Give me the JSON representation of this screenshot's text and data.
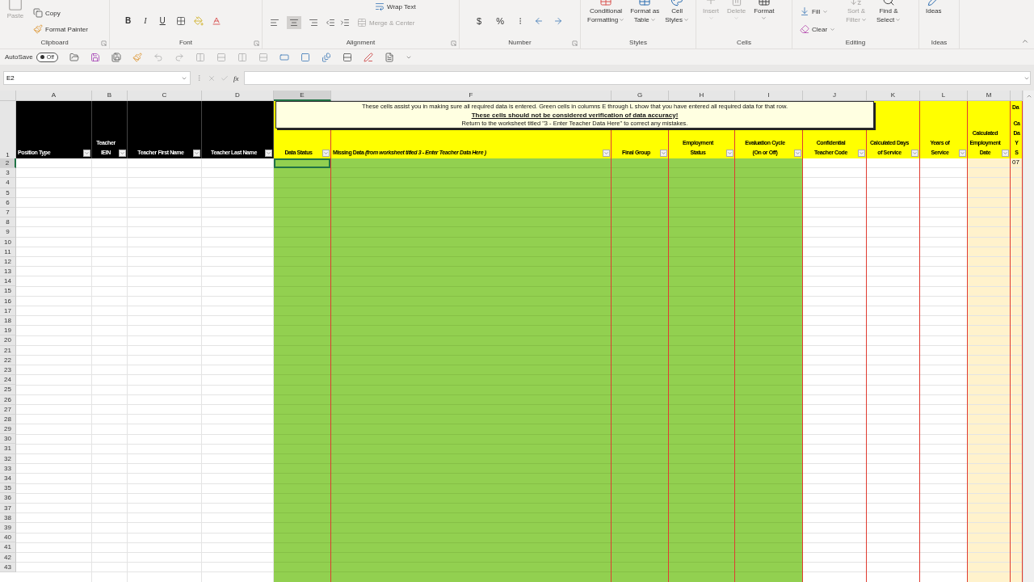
{
  "ribbon": {
    "clipboard": {
      "label": "Clipboard",
      "paste": {
        "label": "Paste",
        "disabled": true
      },
      "copy": "Copy",
      "format_painter": "Format Painter"
    },
    "font": {
      "label": "Font",
      "bold": "B",
      "italic": "I",
      "underline": "U"
    },
    "alignment": {
      "label": "Alignment",
      "wrap_text": "Wrap Text",
      "align": [
        {
          "selected": false
        },
        {
          "selected": true
        },
        {
          "selected": false
        }
      ],
      "merge_center": {
        "label": "Merge & Center",
        "disabled": true
      }
    },
    "number": {
      "label": "Number",
      "currency": "$",
      "percent": "%"
    },
    "styles": {
      "label": "Styles",
      "buttons": [
        {
          "line_1": "Conditional",
          "line_2": "Formatting"
        },
        {
          "line_1": "Format as",
          "line_2": "Table"
        },
        {
          "line_1": "Cell",
          "line_2": "Styles"
        }
      ]
    },
    "cells": {
      "label": "Cells",
      "buttons": [
        {
          "label": "Insert",
          "disabled": true
        },
        {
          "label": "Delete",
          "disabled": true
        },
        {
          "label": "Format",
          "disabled": false
        }
      ]
    },
    "editing": {
      "label": "Editing",
      "fill": "Fill",
      "clear": "Clear",
      "buttons": [
        {
          "line_1": "Sort &",
          "line_2": "Filter",
          "disabled": true
        },
        {
          "line_1": "Find &",
          "line_2": "Select",
          "disabled": false
        }
      ]
    },
    "ideas": {
      "label": "Ideas",
      "button": "Ideas"
    }
  },
  "quick_access": {
    "autosave_label": "AutoSave",
    "autosave_on": false,
    "autosave_state": "Off"
  },
  "formula_bar": {
    "name_box": "E2",
    "function_label": "fx"
  },
  "note": {
    "line_1": "These cells assist you in making sure all required data is entered.  Green cells in columns E through L show that you have entered all required data for that row.",
    "warning": "These cells should not be considered verification of data accuracy!",
    "line_3": "Return to the worksheet titled \"3 - Enter Teacher Data Here\" to correct any mistakes."
  },
  "columns": [
    {
      "letter": "A",
      "header": "Position Type",
      "kind": "input",
      "selected": false
    },
    {
      "letter": "B",
      "header": "Teacher\nIEIN",
      "kind": "input",
      "selected": false
    },
    {
      "letter": "C",
      "header": "Teacher First Name",
      "kind": "input",
      "selected": false
    },
    {
      "letter": "D",
      "header": "Teacher Last Name",
      "kind": "input",
      "selected": false
    },
    {
      "letter": "E",
      "header": "Data Status",
      "kind": "check",
      "selected": true
    },
    {
      "letter": "F",
      "header": "Missing Data *(from worksheet titled 3 - Enter Teacher Data Here )*",
      "kind": "check",
      "selected": false
    },
    {
      "letter": "G",
      "header": "Final Group",
      "kind": "check",
      "selected": false
    },
    {
      "letter": "H",
      "header": "Employment\nStatus",
      "kind": "check",
      "selected": false
    },
    {
      "letter": "I",
      "header": "Evaluation Cycle\n(On or Off)",
      "kind": "check",
      "selected": false
    },
    {
      "letter": "J",
      "header": "Confidential\nTeacher Code",
      "kind": "calc",
      "selected": false
    },
    {
      "letter": "K",
      "header": "Calculated Days\nof Service",
      "kind": "calc",
      "selected": false
    },
    {
      "letter": "L",
      "header": "Years of\nService",
      "kind": "calc",
      "selected": false
    },
    {
      "letter": "M",
      "header": "Calculated\nEmployment\nDate",
      "kind": "date",
      "selected": false
    },
    {
      "header_top": "Da",
      "header": "Ca\nDa\nY\nS",
      "kind": "date",
      "selected": false,
      "first_value": "07"
    }
  ],
  "header_row": "1",
  "rows": [
    {
      "number": "2",
      "selected": true
    },
    {
      "number": "3",
      "selected": false
    },
    {
      "number": "4",
      "selected": false
    },
    {
      "number": "5",
      "selected": false
    },
    {
      "number": "6",
      "selected": false
    },
    {
      "number": "7",
      "selected": false
    },
    {
      "number": "8",
      "selected": false
    },
    {
      "number": "9",
      "selected": false
    },
    {
      "number": "10",
      "selected": false
    },
    {
      "number": "11",
      "selected": false
    },
    {
      "number": "12",
      "selected": false
    },
    {
      "number": "13",
      "selected": false
    },
    {
      "number": "14",
      "selected": false
    },
    {
      "number": "15",
      "selected": false
    },
    {
      "number": "16",
      "selected": false
    },
    {
      "number": "17",
      "selected": false
    },
    {
      "number": "18",
      "selected": false
    },
    {
      "number": "19",
      "selected": false
    },
    {
      "number": "20",
      "selected": false
    },
    {
      "number": "21",
      "selected": false
    },
    {
      "number": "22",
      "selected": false
    },
    {
      "number": "23",
      "selected": false
    },
    {
      "number": "24",
      "selected": false
    },
    {
      "number": "25",
      "selected": false
    },
    {
      "number": "26",
      "selected": false
    },
    {
      "number": "27",
      "selected": false
    },
    {
      "number": "28",
      "selected": false
    },
    {
      "number": "29",
      "selected": false
    },
    {
      "number": "30",
      "selected": false
    },
    {
      "number": "31",
      "selected": false
    },
    {
      "number": "32",
      "selected": false
    },
    {
      "number": "33",
      "selected": false
    },
    {
      "number": "34",
      "selected": false
    },
    {
      "number": "35",
      "selected": false
    },
    {
      "number": "36",
      "selected": false
    },
    {
      "number": "37",
      "selected": false
    },
    {
      "number": "38",
      "selected": false
    },
    {
      "number": "39",
      "selected": false
    },
    {
      "number": "40",
      "selected": false
    },
    {
      "number": "41",
      "selected": false
    },
    {
      "number": "42",
      "selected": false
    },
    {
      "number": "43",
      "selected": false
    }
  ]
}
